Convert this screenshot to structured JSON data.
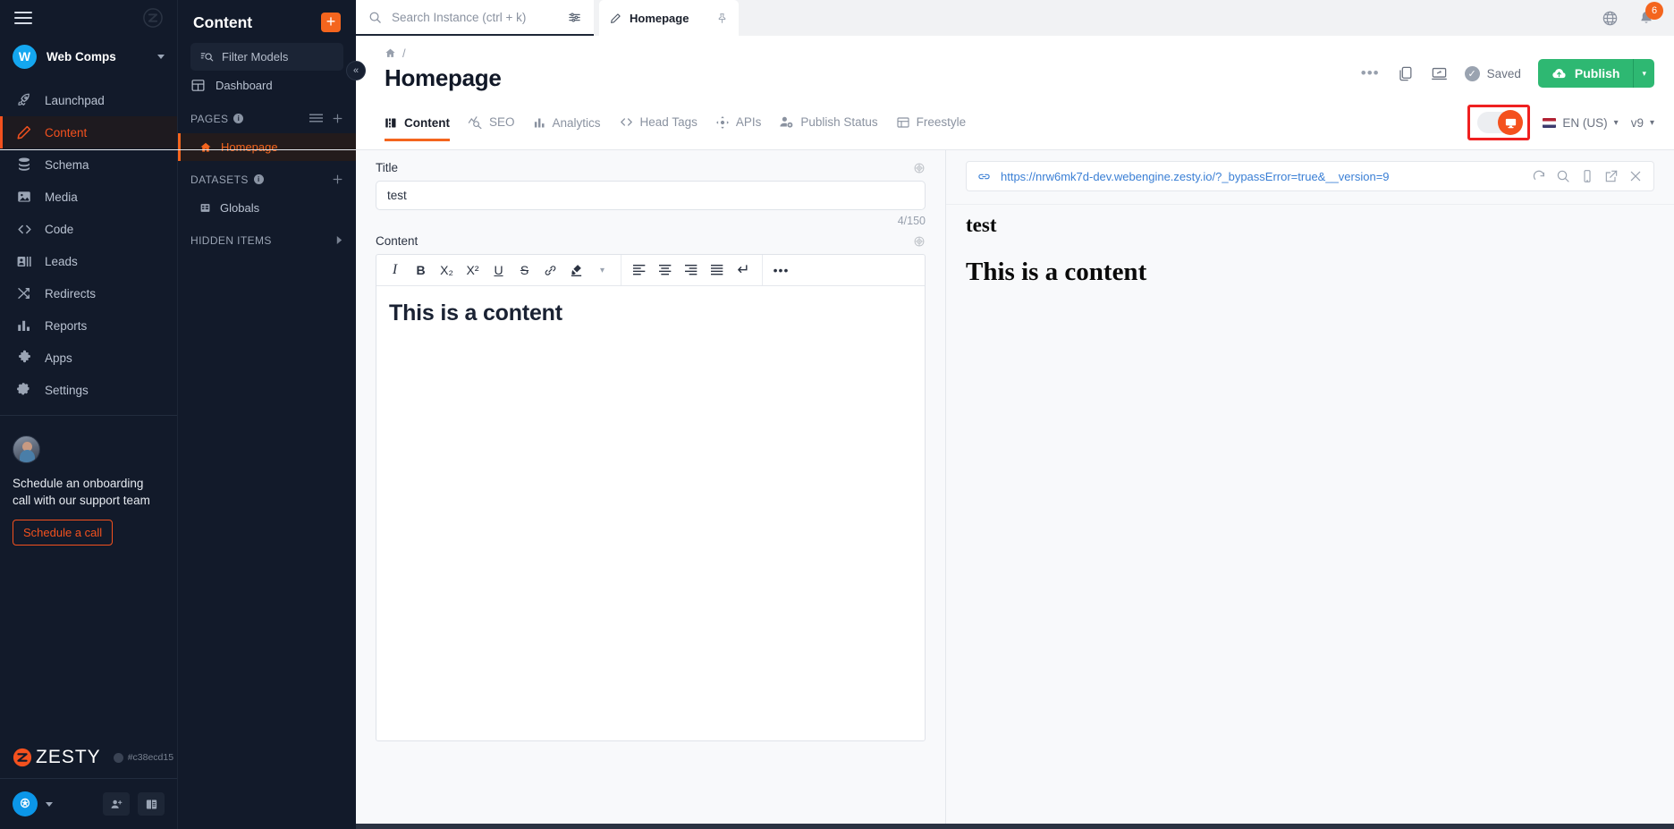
{
  "leftnav": {
    "menu_icon": "hamburger-icon",
    "brand_icon": "zesty-z-icon",
    "workspace": {
      "initial": "W",
      "name": "Web Comps"
    },
    "items": [
      {
        "label": "Launchpad",
        "icon": "rocket-icon",
        "active": false
      },
      {
        "label": "Content",
        "icon": "pencil-icon",
        "active": true
      },
      {
        "label": "Schema",
        "icon": "database-icon",
        "active": false
      },
      {
        "label": "Media",
        "icon": "image-icon",
        "active": false
      },
      {
        "label": "Code",
        "icon": "code-brackets-icon",
        "active": false
      },
      {
        "label": "Leads",
        "icon": "contact-card-icon",
        "active": false
      },
      {
        "label": "Redirects",
        "icon": "shuffle-icon",
        "active": false
      },
      {
        "label": "Reports",
        "icon": "bar-chart-icon",
        "active": false
      },
      {
        "label": "Apps",
        "icon": "puzzle-icon",
        "active": false
      },
      {
        "label": "Settings",
        "icon": "gear-icon",
        "active": false
      }
    ],
    "promo": {
      "text": "Schedule an onboarding call with our support team",
      "button_label": "Schedule a call"
    },
    "brand_word": "ZESTY",
    "commit": "#c38ecd15",
    "footer_icons": [
      "add-user-icon",
      "docs-book-icon"
    ]
  },
  "content_panel": {
    "title": "Content",
    "add_label": "+",
    "filter_placeholder": "Filter Models",
    "dashboard_label": "Dashboard",
    "sections": [
      {
        "label": "PAGES",
        "items": [
          {
            "label": "Homepage",
            "icon": "home-icon",
            "active": true
          }
        ]
      },
      {
        "label": "DATASETS",
        "items": [
          {
            "label": "Globals",
            "icon": "grid-icon",
            "active": false
          }
        ]
      },
      {
        "label": "HIDDEN ITEMS",
        "items": []
      }
    ],
    "collapse_icon": "chevron-double-left-icon"
  },
  "topbar": {
    "search_placeholder": "Search Instance (ctrl + k)",
    "filter_icon": "sliders-icon",
    "tab_label": "Homepage",
    "tab_icon": "pencil-icon",
    "pin_icon": "pin-icon",
    "globe_icon": "globe-icon",
    "bell_icon": "bell-icon",
    "bell_badge": "6"
  },
  "header": {
    "breadcrumb_home_icon": "home-icon",
    "breadcrumb_separator": "/",
    "title": "Homepage",
    "more_label": "•••",
    "copy_icon": "copy-icon",
    "present_icon": "present-screen-icon",
    "saved_label": "Saved",
    "publish_label": "Publish",
    "publish_color": "#2eb872",
    "publish_caret": "▾"
  },
  "tabs": [
    {
      "label": "Content",
      "icon": "content-blocks-icon",
      "active": true
    },
    {
      "label": "SEO",
      "icon": "seo-graph-icon",
      "active": false
    },
    {
      "label": "Analytics",
      "icon": "analytics-bars-icon",
      "active": false
    },
    {
      "label": "Head Tags",
      "icon": "code-brackets-icon",
      "active": false
    },
    {
      "label": "APIs",
      "icon": "api-node-icon",
      "active": false
    },
    {
      "label": "Publish Status",
      "icon": "user-gear-icon",
      "active": false
    },
    {
      "label": "Freestyle",
      "icon": "layout-icon",
      "active": false
    }
  ],
  "tabs_right": {
    "device_toggle_icon": "desktop-monitor-icon",
    "toggle_on": true,
    "highlight_color": "#ef2020",
    "accent_color": "#f4511e",
    "language": "EN (US)",
    "language_caret": "⌵",
    "version": "v9",
    "version_caret": "⌵"
  },
  "editor": {
    "title_field": {
      "label": "Title",
      "value": "test",
      "counter": "4/150",
      "gear_icon": "field-settings-icon"
    },
    "content_field": {
      "label": "Content",
      "gear_icon": "field-settings-icon",
      "toolbar_group_1": [
        {
          "icon": "italic-icon",
          "glyph": "I"
        },
        {
          "icon": "bold-icon",
          "glyph": "B"
        },
        {
          "icon": "subscript-icon",
          "glyph": "X₂"
        },
        {
          "icon": "superscript-icon",
          "glyph": "X²"
        },
        {
          "icon": "underline-icon",
          "glyph": "U"
        },
        {
          "icon": "strikethrough-icon",
          "glyph": "S"
        },
        {
          "icon": "link-icon",
          "glyph": "🔗"
        },
        {
          "icon": "highlight-pen-icon",
          "glyph": "✎"
        },
        {
          "icon": "chevron-down-icon",
          "glyph": "⌵"
        }
      ],
      "toolbar_group_2": [
        {
          "icon": "align-left-icon",
          "glyph": ""
        },
        {
          "icon": "align-center-icon",
          "glyph": ""
        },
        {
          "icon": "align-right-icon",
          "glyph": ""
        },
        {
          "icon": "align-justify-icon",
          "glyph": ""
        },
        {
          "icon": "line-break-icon",
          "glyph": "↵"
        }
      ],
      "toolbar_group_3": [
        {
          "icon": "more-options-icon",
          "glyph": "•••"
        }
      ],
      "body_heading": "This is a content"
    }
  },
  "preview": {
    "link_icon": "link-chain-icon",
    "url": "https://nrw6mk7d-dev.webengine.zesty.io/?_bypassError=true&__version=9",
    "actions": [
      {
        "icon": "refresh-icon"
      },
      {
        "icon": "zoom-search-icon"
      },
      {
        "icon": "mobile-device-icon"
      },
      {
        "icon": "open-external-icon"
      },
      {
        "icon": "close-icon"
      }
    ],
    "page_heading": "test",
    "page_subheading": "This is a content"
  }
}
